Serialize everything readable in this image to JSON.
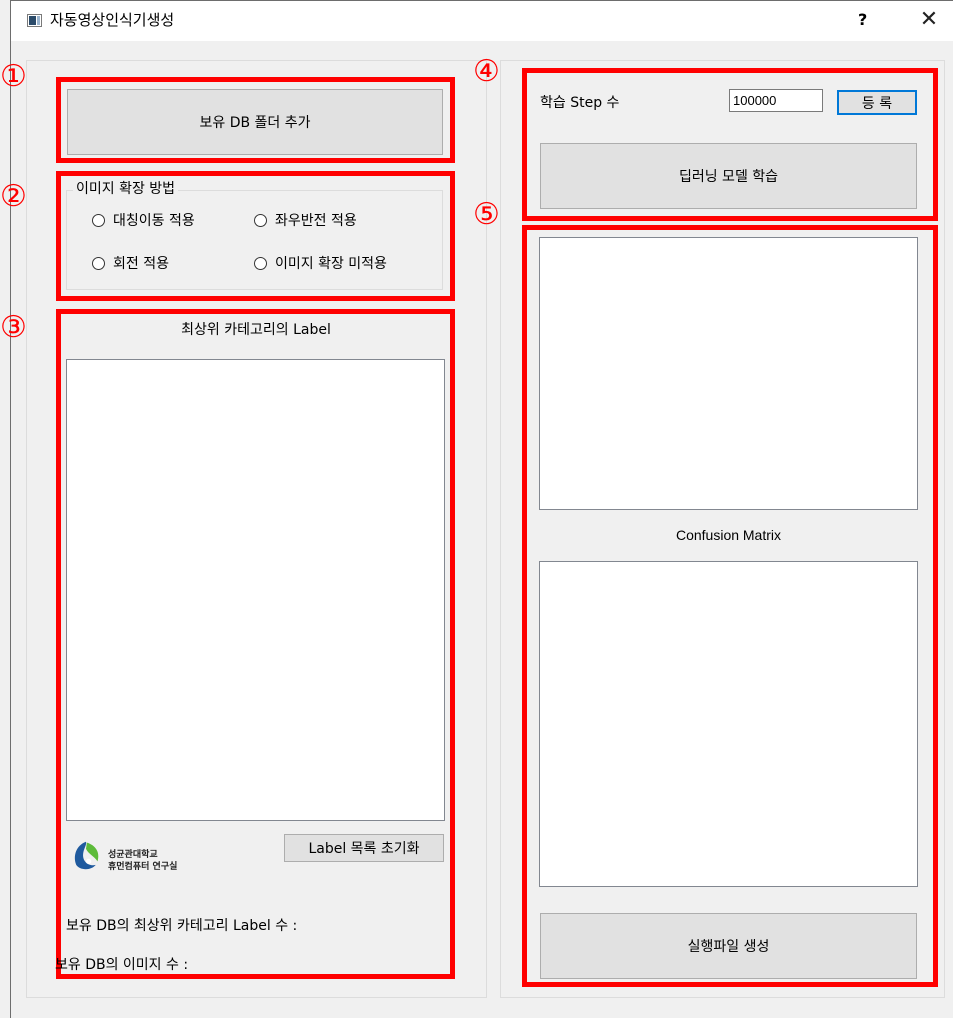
{
  "window": {
    "title": "자동영상인식기생성",
    "help_label": "?",
    "close_label": "✕"
  },
  "annotations": [
    "①",
    "②",
    "③",
    "④",
    "⑤"
  ],
  "section1": {
    "add_db_button": "보유 DB 폴더 추가"
  },
  "section2": {
    "legend": "이미지 확장 방법",
    "options": [
      "대칭이동 적용",
      "좌우반전 적용",
      "회전 적용",
      "이미지 확장 미적용"
    ]
  },
  "section3": {
    "header": "최상위 카테고리의 Label",
    "reset_button": "Label 목록 초기화",
    "logo_line1": "성균관대학교",
    "logo_line2": "휴먼컴퓨터 연구실",
    "label_count_text": "보유 DB의 최상위 카테고리 Label 수 :",
    "image_count_text": "보유 DB의 이미지 수 :"
  },
  "section4": {
    "step_label": "학습 Step 수",
    "step_value": "100000",
    "register_button": "등 록",
    "train_button": "딥러닝 모델 학습"
  },
  "section5": {
    "matrix_label": "Confusion Matrix",
    "build_button": "실행파일 생성"
  },
  "colors": {
    "annotation": "#ff0000",
    "focus": "#0078d7"
  },
  "icons": {
    "window": "app-window-icon",
    "logo": "skku-logo-icon"
  }
}
